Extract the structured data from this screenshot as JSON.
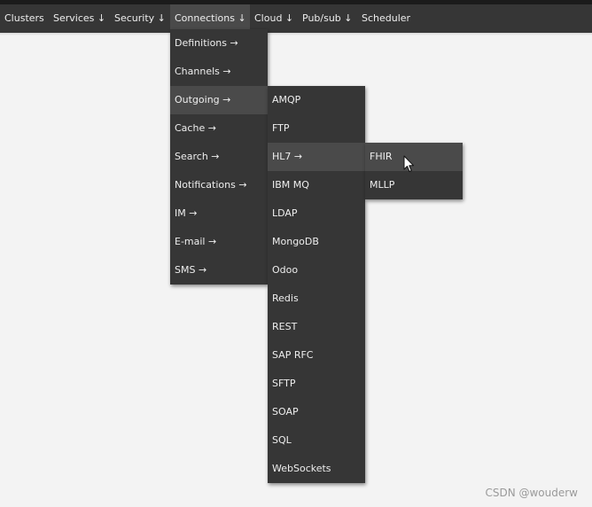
{
  "navbar": {
    "items": [
      {
        "label": "Clusters"
      },
      {
        "label": "Services ↓"
      },
      {
        "label": "Security ↓"
      },
      {
        "label": "Connections ↓"
      },
      {
        "label": "Cloud ↓"
      },
      {
        "label": "Pub/sub ↓"
      },
      {
        "label": "Scheduler"
      }
    ],
    "active_item": "Connections ↓"
  },
  "menus": {
    "connections": {
      "items": [
        {
          "label": "Definitions →"
        },
        {
          "label": "Channels →"
        },
        {
          "label": "Outgoing →"
        },
        {
          "label": "Cache →"
        },
        {
          "label": "Search →"
        },
        {
          "label": "Notifications →"
        },
        {
          "label": "IM →"
        },
        {
          "label": "E-mail →"
        },
        {
          "label": "SMS →"
        }
      ],
      "active_item": "Outgoing →"
    },
    "outgoing": {
      "items": [
        {
          "label": "AMQP"
        },
        {
          "label": "FTP"
        },
        {
          "label": "HL7 →"
        },
        {
          "label": "IBM MQ"
        },
        {
          "label": "LDAP"
        },
        {
          "label": "MongoDB"
        },
        {
          "label": "Odoo"
        },
        {
          "label": "Redis"
        },
        {
          "label": "REST"
        },
        {
          "label": "SAP RFC"
        },
        {
          "label": "SFTP"
        },
        {
          "label": "SOAP"
        },
        {
          "label": "SQL"
        },
        {
          "label": "WebSockets"
        }
      ],
      "active_item": "HL7 →"
    },
    "hl7": {
      "items": [
        {
          "label": "FHIR"
        },
        {
          "label": "MLLP"
        }
      ],
      "active_item": "FHIR"
    }
  },
  "watermark": "CSDN @wouderw",
  "colors": {
    "navbar_bg": "#363636",
    "menu_bg": "#363636",
    "highlight_bg": "#4a4a4a",
    "page_bg": "#f3f3f3",
    "text": "#eeeeee"
  }
}
